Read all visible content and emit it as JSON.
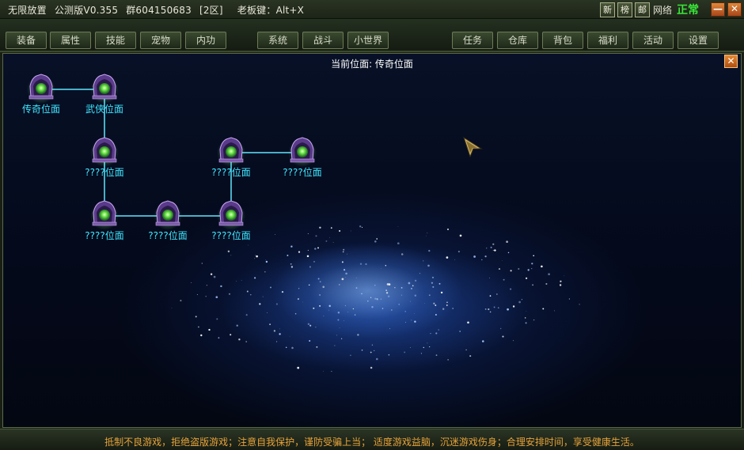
{
  "title_bar": {
    "game_name": "无限放置",
    "version": "公测版V0.355",
    "group": "群604150683",
    "server": "[2区]",
    "boss_key": "老板键：Alt+X",
    "buttons": [
      "新",
      "榜",
      "邮"
    ],
    "network_label": "网络",
    "network_status": "正常",
    "minimize": "—",
    "close": "✕"
  },
  "tabs": [
    {
      "label": "装备",
      "active": false
    },
    {
      "label": "属性",
      "active": false
    },
    {
      "label": "技能",
      "active": false
    },
    {
      "label": "宠物",
      "active": true
    },
    {
      "label": "内功",
      "active": false
    },
    {
      "label": "系统",
      "active": true
    },
    {
      "label": "战斗",
      "active": false
    },
    {
      "label": "小世界",
      "active": false
    },
    {
      "label": "任务",
      "active": false
    },
    {
      "label": "仓库",
      "active": false
    },
    {
      "label": "背包",
      "active": false
    },
    {
      "label": "福利",
      "active": false
    },
    {
      "label": "活动",
      "active": true
    },
    {
      "label": "设置",
      "active": false
    }
  ],
  "panel": {
    "title": "当前位面: 传奇位面",
    "close": "✕"
  },
  "plane_nodes": [
    {
      "id": "n1",
      "label": "传奇位面"
    },
    {
      "id": "n2",
      "label": "武侠位面"
    },
    {
      "id": "n3",
      "label": "????位面"
    },
    {
      "id": "n4",
      "label": "????位面"
    },
    {
      "id": "n5",
      "label": "????位面"
    },
    {
      "id": "n6",
      "label": "????位面"
    },
    {
      "id": "n7",
      "label": "????位面"
    },
    {
      "id": "n8",
      "label": "????位面"
    }
  ],
  "plane_links": [
    [
      "n1",
      "n2"
    ],
    [
      "n2",
      "n3"
    ],
    [
      "n3",
      "n4"
    ],
    [
      "n4",
      "n5"
    ],
    [
      "n5",
      "n6"
    ],
    [
      "n6",
      "n7"
    ],
    [
      "n7",
      "n8"
    ]
  ],
  "footer": {
    "notice": "抵制不良游戏，拒绝盗版游戏；注意自我保护，谨防受骗上当； 适度游戏益脑，沉迷游戏伤身；合理安排时间，享受健康生活。"
  },
  "colors": {
    "link": "#5fe6ff",
    "label": "#3ee6ff",
    "network_ok": "#39e639",
    "notice": "#e6a23a"
  }
}
